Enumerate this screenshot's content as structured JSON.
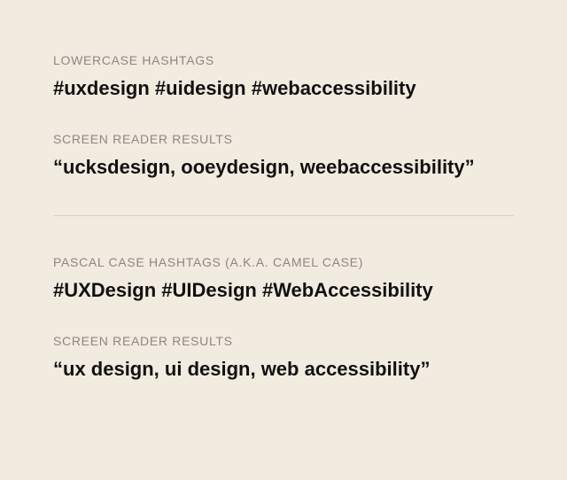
{
  "section1": {
    "label": "LOWERCASE HASHTAGS",
    "content": "#uxdesign #uidesign #webaccessibility"
  },
  "section2": {
    "label": "SCREEN READER RESULTS",
    "content": "“ucksdesign, ooeydesign, weebaccessibility”"
  },
  "section3": {
    "label": "PASCAL CASE HASHTAGS (A.K.A. CAMEL CASE)",
    "content": "#UXDesign #UIDesign #WebAccessibility"
  },
  "section4": {
    "label": "SCREEN READER RESULTS",
    "content": "“ux design, ui design, web accessibility”"
  }
}
